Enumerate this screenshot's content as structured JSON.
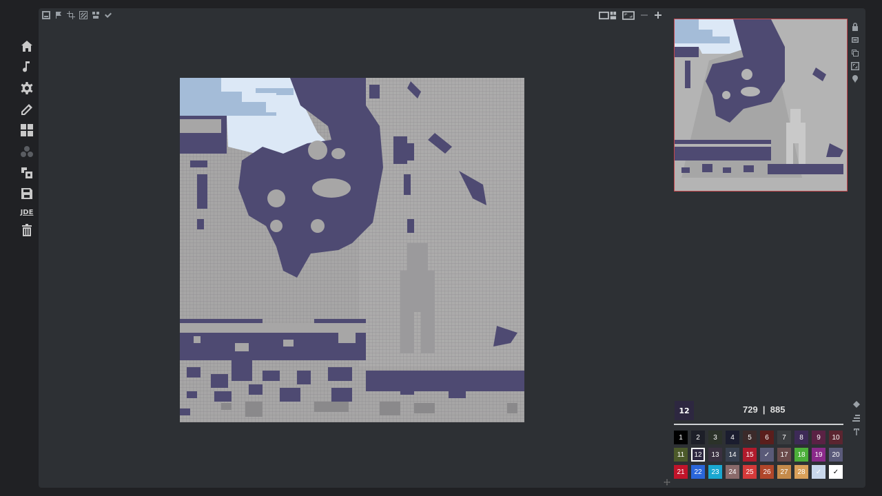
{
  "sidebar": {
    "items": [
      {
        "name": "home-icon"
      },
      {
        "name": "music-note-icon"
      },
      {
        "name": "gear-icon"
      },
      {
        "name": "pencil-icon"
      },
      {
        "name": "grid-layout-icon"
      },
      {
        "name": "bubbles-icon"
      },
      {
        "name": "import-icon"
      },
      {
        "name": "save-icon"
      },
      {
        "name": "jde-label",
        "text": "JDE"
      },
      {
        "name": "trash-icon"
      }
    ]
  },
  "top_toolbar": {
    "tools": [
      "frame-icon",
      "flag-icon",
      "crop-icon",
      "hatch-icon",
      "stamp-icon",
      "check-icon"
    ]
  },
  "view_toolbar": {
    "tools": [
      "split-view-icon",
      "fit-screen-icon",
      "zoom-out-icon",
      "zoom-in-icon"
    ]
  },
  "minimap_tools": [
    "lock-icon",
    "layer-icon",
    "copy-icon",
    "fullscreen-icon",
    "pin-icon"
  ],
  "palette": {
    "current_index": "12",
    "coords": "729  |  885",
    "swatches": [
      {
        "label": "1",
        "color": "#000000"
      },
      {
        "label": "2",
        "color": "#1d1f28"
      },
      {
        "label": "3",
        "color": "#2b3229"
      },
      {
        "label": "4",
        "color": "#1b1d2f"
      },
      {
        "label": "5",
        "color": "#3b2a2a"
      },
      {
        "label": "6",
        "color": "#5a1e1c"
      },
      {
        "label": "7",
        "color": "#3a3d40"
      },
      {
        "label": "8",
        "color": "#3d2a57"
      },
      {
        "label": "9",
        "color": "#5a2244"
      },
      {
        "label": "10",
        "color": "#5b2530"
      },
      {
        "label": "11",
        "color": "#4c5a2a"
      },
      {
        "label": "12",
        "color": "#2d2740",
        "selected": true
      },
      {
        "label": "13",
        "color": "#3a3040"
      },
      {
        "label": "14",
        "color": "#384050"
      },
      {
        "label": "15",
        "color": "#b01b2c"
      },
      {
        "label": "✓",
        "color": "#5a5a78"
      },
      {
        "label": "17",
        "color": "#6a4a4a"
      },
      {
        "label": "18",
        "color": "#4caf3a"
      },
      {
        "label": "19",
        "color": "#8a2a8a"
      },
      {
        "label": "20",
        "color": "#5a5a7a"
      },
      {
        "label": "21",
        "color": "#c0142a"
      },
      {
        "label": "22",
        "color": "#2a66d9"
      },
      {
        "label": "23",
        "color": "#1aa7d0"
      },
      {
        "label": "24",
        "color": "#8a6a6a"
      },
      {
        "label": "25",
        "color": "#d43a3a"
      },
      {
        "label": "26",
        "color": "#b0462a"
      },
      {
        "label": "27",
        "color": "#c48a4a"
      },
      {
        "label": "28",
        "color": "#d9a05a"
      },
      {
        "label": "✓",
        "color": "#c9d8ec"
      },
      {
        "label": "✓",
        "color": "#ffffff",
        "dark": true
      }
    ]
  },
  "palette_tools": [
    "fill-icon",
    "list-icon",
    "font-icon"
  ],
  "colors": {
    "workspace_bg": "#2d3034",
    "pixel_light": "#a7a6a6",
    "pixel_dark": "#4e4a72",
    "sky": "#dce8f6",
    "cloud": "#a4bcd8",
    "minimap_border": "#c8474d"
  }
}
